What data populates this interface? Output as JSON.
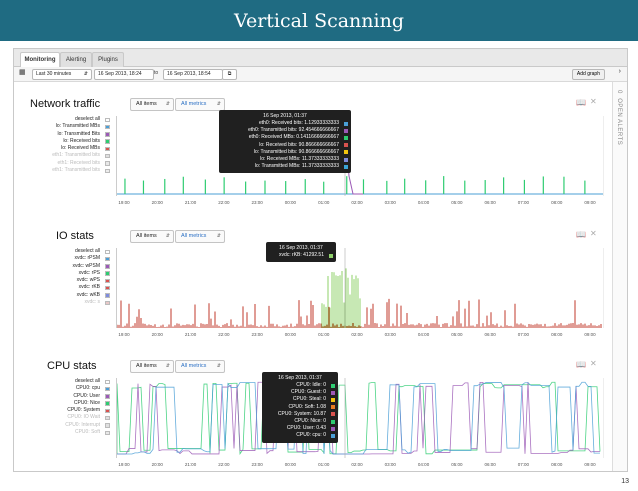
{
  "slide": {
    "title": "Vertical Scanning",
    "page_number": "13"
  },
  "tabs": [
    {
      "label": "Monitoring",
      "active": true
    },
    {
      "label": "Alerting",
      "active": false
    },
    {
      "label": "Plugins",
      "active": false
    }
  ],
  "toolbar": {
    "range_select": "Last 30 minutes",
    "from": "16 Sep 2013, 18:24",
    "to_label": "to",
    "to": "16 Sep 2013, 18:54",
    "add_graph": "Add graph"
  },
  "sidebar": {
    "alerts_count": "0",
    "alerts_label": "OPEN ALERTS"
  },
  "x_ticks": [
    "19:00",
    "20:00",
    "21:00",
    "22:00",
    "23:00",
    "00:00",
    "01:00",
    "02:00",
    "03:00",
    "04:00",
    "05:00",
    "06:00",
    "07:00",
    "08:00",
    "09:00"
  ],
  "panels": [
    {
      "title": "Network traffic",
      "items_dropdown": "All items",
      "metrics_dropdown": "All metrics",
      "legend": [
        {
          "label": "deselect all",
          "color": "#ffffff",
          "faded": false
        },
        {
          "label": "lo: Transmitted MBs",
          "color": "#4a9fd6",
          "faded": false
        },
        {
          "label": "lo: Transmitted Bits",
          "color": "#9b59b6",
          "faded": false
        },
        {
          "label": "lo: Received bits",
          "color": "#2ecc71",
          "faded": false
        },
        {
          "label": "lo: Received MBs",
          "color": "#d9534f",
          "faded": false
        },
        {
          "label": "eth1: Transmitted bits",
          "color": "#e0e0e0",
          "faded": true
        },
        {
          "label": "eth1: Received bits",
          "color": "#e8e8e8",
          "faded": true
        },
        {
          "label": "eth1: Transmitted bits",
          "color": "#ececec",
          "faded": true
        }
      ],
      "tooltip": {
        "time": "16 Sep 2013, 01:37",
        "rows": [
          {
            "label": "eth0: Received bits: 1.12933333333",
            "color": "#4a9fd6"
          },
          {
            "label": "eth0: Transmitted bits: 92.454666666667",
            "color": "#9b59b6"
          },
          {
            "label": "eth0: Received MBs: 0.14116666666667",
            "color": "#2ecc71"
          },
          {
            "label": "lo: Received bits: 90.866666666667",
            "color": "#d9534f"
          },
          {
            "label": "lo: Transmitted bits: 90.866666666667",
            "color": "#f1c40f"
          },
          {
            "label": "lo: Received MBs: 11.37333333333",
            "color": "#7f8cde"
          },
          {
            "label": "lo: Transmitted MBs: 11.37333333333",
            "color": "#3aa6d8"
          }
        ]
      }
    },
    {
      "title": "IO stats",
      "items_dropdown": "All items",
      "metrics_dropdown": "All metrics",
      "legend": [
        {
          "label": "deselect all",
          "color": "#ffffff",
          "faded": false
        },
        {
          "label": "xvdc: rPSM",
          "color": "#4a9fd6",
          "faded": false
        },
        {
          "label": "xvdc: wPSM",
          "color": "#9b59b6",
          "faded": false
        },
        {
          "label": "xvdc: rPS",
          "color": "#2ecc71",
          "faded": false
        },
        {
          "label": "xvdc: wPS",
          "color": "#d9534f",
          "faded": false
        },
        {
          "label": "xvdc: rKB",
          "color": "#d9534f",
          "faded": false
        },
        {
          "label": "xvdc: wKB",
          "color": "#7f8cde",
          "faded": false
        },
        {
          "label": "xvdc: s",
          "color": "#e8c8c8",
          "faded": true
        }
      ],
      "tooltip": {
        "time": "16 Sep 2013, 01:37",
        "rows": [
          {
            "label": "xvdc: rKB: 41292.51",
            "color": "#8fd16a"
          }
        ]
      }
    },
    {
      "title": "CPU stats",
      "items_dropdown": "All items",
      "metrics_dropdown": "All metrics",
      "legend": [
        {
          "label": "deselect all",
          "color": "#ffffff",
          "faded": false
        },
        {
          "label": "CPU0: cpu",
          "color": "#4a9fd6",
          "faded": false
        },
        {
          "label": "CPU0: User",
          "color": "#9b59b6",
          "faded": false
        },
        {
          "label": "CPU0: Nice",
          "color": "#2ecc71",
          "faded": false
        },
        {
          "label": "CPU0: System",
          "color": "#d9534f",
          "faded": false
        },
        {
          "label": "CPU0: IO Wait",
          "color": "#e0e0e0",
          "faded": true
        },
        {
          "label": "CPU0: Interrupt",
          "color": "#e0e0e0",
          "faded": true
        },
        {
          "label": "CPU0: Soft",
          "color": "#e8e8e8",
          "faded": true
        }
      ],
      "tooltip": {
        "time": "16 Sep 2013, 01:37",
        "rows": [
          {
            "label": "CPU0: Idle: 0",
            "color": "#2ecc71"
          },
          {
            "label": "CPU0: Guest: 0",
            "color": "#9b59b6"
          },
          {
            "label": "CPU0: Steal: 0",
            "color": "#f1c40f"
          },
          {
            "label": "CPU0: Soft: 1.08",
            "color": "#e67e22"
          },
          {
            "label": "CPU0: System: 10.87",
            "color": "#d9534f"
          },
          {
            "label": "CPU0: Nice: 0",
            "color": "#2ecc71"
          },
          {
            "label": "CPU0: User: 0.43",
            "color": "#9b59b6"
          },
          {
            "label": "CPU0: cpu: 0",
            "color": "#4a9fd6"
          }
        ]
      }
    }
  ],
  "colors": {
    "banner": "#1f6b82"
  }
}
